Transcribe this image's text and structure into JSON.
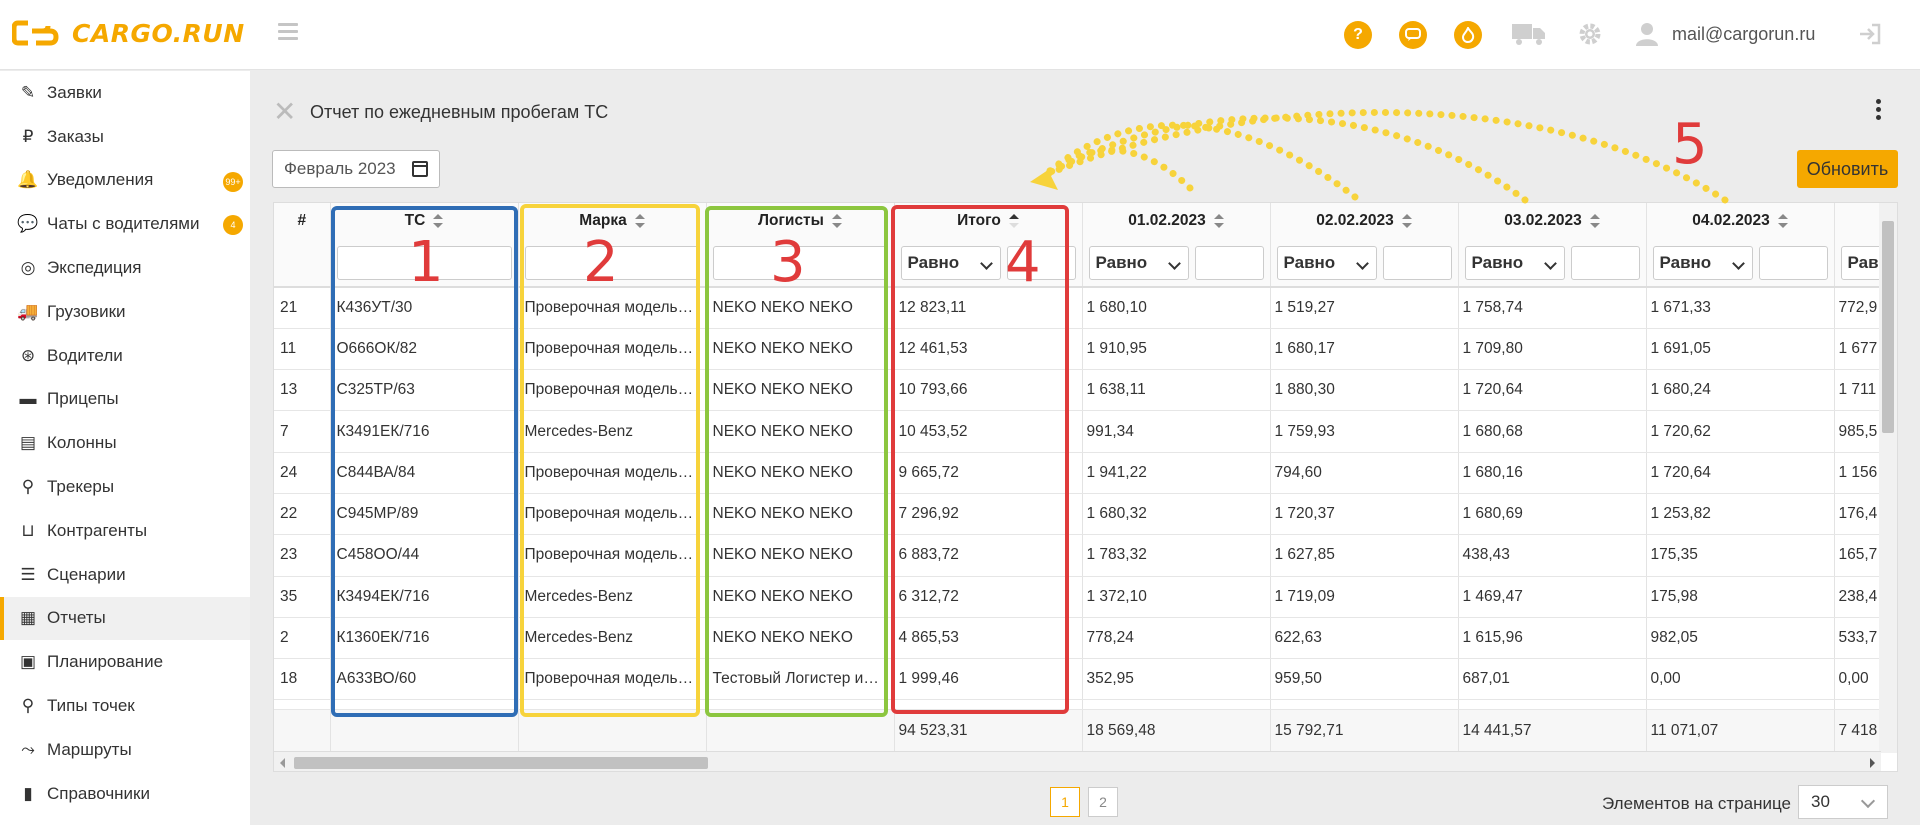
{
  "header": {
    "logo_text": "CARGO.RUN",
    "user_email": "mail@cargorun.ru",
    "help_icon_glyph": "?",
    "brand_color": "#f5a800"
  },
  "sidebar": {
    "items": [
      {
        "label": "Заявки",
        "icon": "edit-icon",
        "glyph": "✎"
      },
      {
        "label": "Заказы",
        "icon": "ruble-icon",
        "glyph": "₽"
      },
      {
        "label": "Уведомления",
        "icon": "bell-icon",
        "glyph": "🔔",
        "badge": "99+"
      },
      {
        "label": "Чаты с водителями",
        "icon": "chat-icon",
        "glyph": "💬",
        "badge": "4"
      },
      {
        "label": "Экспедиция",
        "icon": "compass-icon",
        "glyph": "◎"
      },
      {
        "label": "Грузовики",
        "icon": "truck-icon",
        "glyph": "🚚"
      },
      {
        "label": "Водители",
        "icon": "steering-wheel-icon",
        "glyph": "⊛"
      },
      {
        "label": "Прицепы",
        "icon": "trailer-icon",
        "glyph": "▬"
      },
      {
        "label": "Колонны",
        "icon": "warehouse-icon",
        "glyph": "▤"
      },
      {
        "label": "Трекеры",
        "icon": "map-pin-icon",
        "glyph": "⚲"
      },
      {
        "label": "Контрагенты",
        "icon": "dolly-icon",
        "glyph": "⊔"
      },
      {
        "label": "Сценарии",
        "icon": "list-icon",
        "glyph": "☰"
      },
      {
        "label": "Отчеты",
        "icon": "clipboard-icon",
        "glyph": "▦",
        "active": true
      },
      {
        "label": "Планирование",
        "icon": "calendar-icon",
        "glyph": "▣"
      },
      {
        "label": "Типы точек",
        "icon": "map-pin-icon",
        "glyph": "⚲"
      },
      {
        "label": "Маршруты",
        "icon": "route-icon",
        "glyph": "⤳"
      },
      {
        "label": "Справочники",
        "icon": "book-icon",
        "glyph": "▮"
      }
    ]
  },
  "main": {
    "title": "Отчет по ежедневным пробегам ТС",
    "month_value": "Февраль 2023",
    "refresh_label": "Обновить",
    "filter_equal_label": "Равно",
    "columns": [
      {
        "label": "#"
      },
      {
        "label": "ТС"
      },
      {
        "label": "Марка"
      },
      {
        "label": "Логисты"
      },
      {
        "label": "Итого"
      },
      {
        "label": "01.02.2023"
      },
      {
        "label": "02.02.2023"
      },
      {
        "label": "03.02.2023"
      },
      {
        "label": "04.02.2023"
      },
      {
        "label": "Равн"
      }
    ],
    "rows": [
      [
        "21",
        "К436УТ/30",
        "Проверочная модель…",
        "NEKO NEKO NEKO",
        "12 823,11",
        "1 680,10",
        "1 519,27",
        "1 758,74",
        "1 671,33",
        "772,9"
      ],
      [
        "11",
        "О666ОК/82",
        "Проверочная модель…",
        "NEKO NEKO NEKO",
        "12 461,53",
        "1 910,95",
        "1 680,17",
        "1 709,80",
        "1 691,05",
        "1 677"
      ],
      [
        "13",
        "С325ТР/63",
        "Проверочная модель…",
        "NEKO NEKO NEKO",
        "10 793,66",
        "1 638,11",
        "1 880,30",
        "1 720,64",
        "1 680,24",
        "1 711"
      ],
      [
        "7",
        "К3491ЕК/716",
        "Mercedes-Benz",
        "NEKO NEKO NEKO",
        "10 453,52",
        "991,34",
        "1 759,93",
        "1 680,68",
        "1 720,62",
        "985,5"
      ],
      [
        "24",
        "С844ВА/84",
        "Проверочная модель…",
        "NEKO NEKO NEKO",
        "9 665,72",
        "1 941,22",
        "794,60",
        "1 680,16",
        "1 720,64",
        "1 156"
      ],
      [
        "22",
        "С945МР/89",
        "Проверочная модель…",
        "NEKO NEKO NEKO",
        "7 296,92",
        "1 680,32",
        "1 720,37",
        "1 680,69",
        "1 253,82",
        "176,4"
      ],
      [
        "23",
        "С458ОО/44",
        "Проверочная модель…",
        "NEKO NEKO NEKO",
        "6 883,72",
        "1 783,32",
        "1 627,85",
        "438,43",
        "175,35",
        "165,7"
      ],
      [
        "35",
        "К3494ЕК/716",
        "Mercedes-Benz",
        "NEKO NEKO NEKO",
        "6 312,72",
        "1 372,10",
        "1 719,09",
        "1 469,47",
        "175,98",
        "238,4"
      ],
      [
        "2",
        "К1360ЕК/716",
        "Mercedes-Benz",
        "NEKO NEKO NEKO",
        "4 865,53",
        "778,24",
        "622,63",
        "1 615,96",
        "982,05",
        "533,7"
      ],
      [
        "18",
        "А633ВО/60",
        "Проверочная модель…",
        "Тестовый Логистер и…",
        "1 999,46",
        "352,95",
        "959,50",
        "687,01",
        "0,00",
        "0,00"
      ]
    ],
    "totals": [
      "",
      "",
      "",
      "",
      "94 523,31",
      "18 569,48",
      "15 792,71",
      "14 441,57",
      "11 071,07",
      "7 418"
    ],
    "pagination": {
      "pages": [
        "1",
        "2"
      ],
      "active_page": "1"
    },
    "per_page_label": "Элементов на странице",
    "per_page_value": "30"
  },
  "annotations": {
    "labels": [
      "1",
      "2",
      "3",
      "4",
      "5"
    ],
    "colors": {
      "1": "#2f6db5",
      "2": "#f7d33b",
      "3": "#8cc63f",
      "4": "#e03b3b",
      "arrows": "#f7d33b"
    }
  }
}
